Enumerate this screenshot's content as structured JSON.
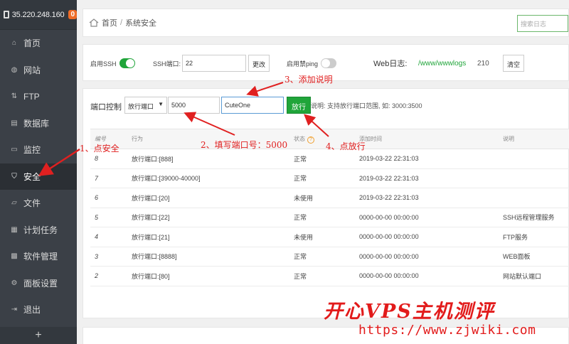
{
  "server": {
    "ip": "35.220.248.160",
    "badge": "0"
  },
  "sidebar": {
    "items": [
      {
        "label": "首页",
        "icon": "home-icon"
      },
      {
        "label": "网站",
        "icon": "globe-icon"
      },
      {
        "label": "FTP",
        "icon": "ftp-icon"
      },
      {
        "label": "数据库",
        "icon": "database-icon"
      },
      {
        "label": "监控",
        "icon": "monitor-icon"
      },
      {
        "label": "安全",
        "icon": "shield-icon"
      },
      {
        "label": "文件",
        "icon": "folder-icon"
      },
      {
        "label": "计划任务",
        "icon": "task-icon"
      },
      {
        "label": "软件管理",
        "icon": "software-icon"
      },
      {
        "label": "面板设置",
        "icon": "settings-icon"
      },
      {
        "label": "退出",
        "icon": "logout-icon"
      }
    ],
    "plus": "+"
  },
  "breadcrumb": {
    "home": "首页",
    "sep": "/",
    "current": "系统安全"
  },
  "search": {
    "placeholder": "搜索日志"
  },
  "ssh": {
    "enable_label": "启用SSH",
    "port_label": "SSH端口:",
    "port_value": "22",
    "change_button": "更改",
    "ping_label": "启用禁ping"
  },
  "weblog": {
    "label": "Web日志:",
    "path": "/www/wwwlogs",
    "size": "210",
    "clear_button": "清空"
  },
  "port_control": {
    "title": "端口控制",
    "select_value": "放行端口",
    "port_input": "5000",
    "desc_input": "CuteOne",
    "allow_button": "放行",
    "hint": "说明: 支持放行端口范围, 如: 3000:3500"
  },
  "table": {
    "headers": [
      "编号",
      "行为",
      "状态",
      "添加时间",
      "说明"
    ],
    "status_help": "?",
    "rows": [
      [
        "8",
        "放行端口:[888]",
        "正常",
        "2019-03-22 22:31:03",
        ""
      ],
      [
        "7",
        "放行端口:[39000-40000]",
        "正常",
        "2019-03-22 22:31:03",
        ""
      ],
      [
        "6",
        "放行端口:[20]",
        "未使用",
        "2019-03-22 22:31:03",
        ""
      ],
      [
        "5",
        "放行端口:[22]",
        "正常",
        "0000-00-00 00:00:00",
        "SSH远程管理服务"
      ],
      [
        "4",
        "放行端口:[21]",
        "未使用",
        "0000-00-00 00:00:00",
        "FTP服务"
      ],
      [
        "3",
        "放行端口:[8888]",
        "正常",
        "0000-00-00 00:00:00",
        "WEB面板"
      ],
      [
        "2",
        "放行端口:[80]",
        "正常",
        "0000-00-00 00:00:00",
        "网站默认端口"
      ]
    ]
  },
  "annotations": {
    "a1": "1、点安全",
    "a2": "2、填写端口号：5000",
    "a3": "3、添加说明",
    "a4": "4、点放行"
  },
  "watermark": {
    "title": "开心VPS主机测评",
    "url": "https://www.zjwiki.com"
  },
  "colors": {
    "accent": "#20a53a",
    "annotation": "#e02020",
    "sidebar": "#3b4047"
  }
}
